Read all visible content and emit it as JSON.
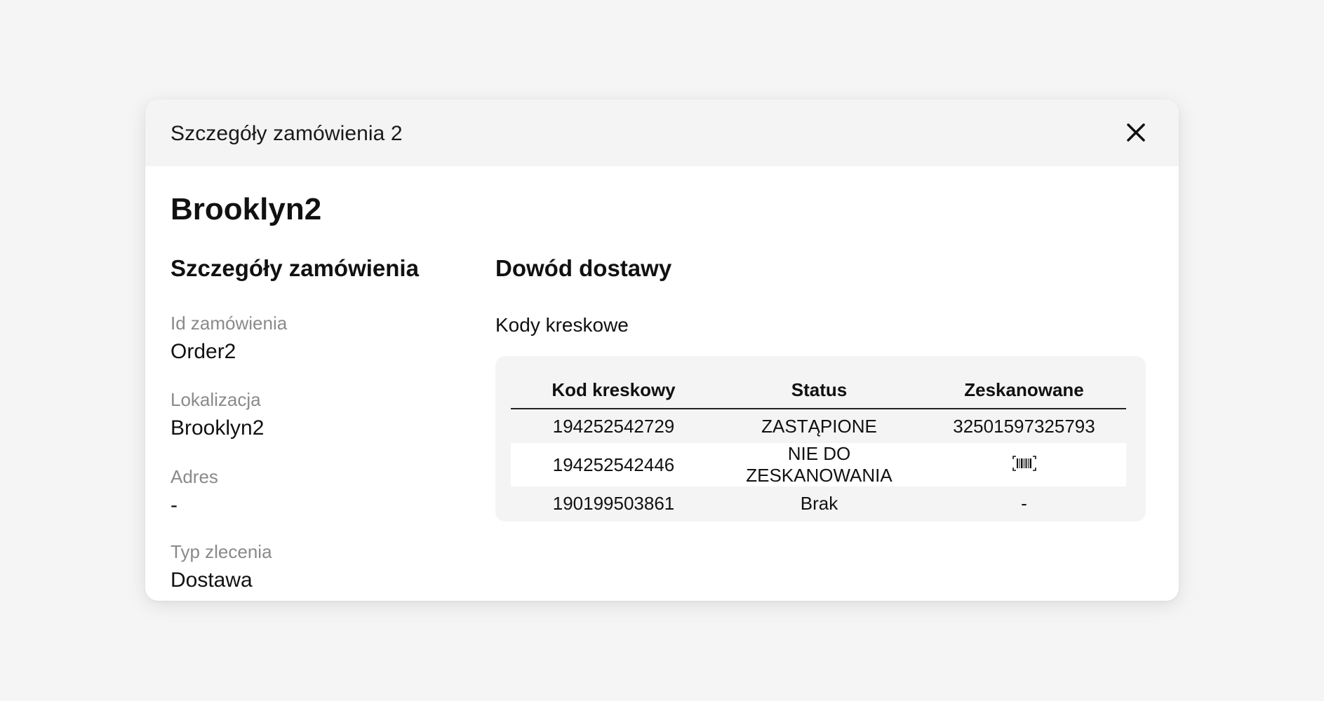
{
  "modal": {
    "title": "Szczegóły zamówienia 2",
    "location_title": "Brooklyn2"
  },
  "order_details": {
    "heading": "Szczegóły zamówienia",
    "fields": [
      {
        "label": "Id zamówienia",
        "value": "Order2"
      },
      {
        "label": "Lokalizacja",
        "value": "Brooklyn2"
      },
      {
        "label": "Adres",
        "value": "-"
      },
      {
        "label": "Typ zlecenia",
        "value": "Dostawa"
      }
    ]
  },
  "proof_of_delivery": {
    "heading": "Dowód dostawy",
    "barcodes_label": "Kody kreskowe",
    "table": {
      "headers": [
        "Kod kreskowy",
        "Status",
        "Zeskanowane"
      ],
      "rows": [
        {
          "code": "194252542729",
          "status": "ZASTĄPIONE",
          "scanned": "32501597325793"
        },
        {
          "code": "194252542446",
          "status": "NIE DO ZESKANOWANIA",
          "scanned": "",
          "scanned_icon": "barcode-icon"
        },
        {
          "code": "190199503861",
          "status": "Brak",
          "scanned": "-"
        }
      ]
    }
  },
  "icons": {
    "close": "close-icon",
    "barcode": "barcode-icon"
  }
}
